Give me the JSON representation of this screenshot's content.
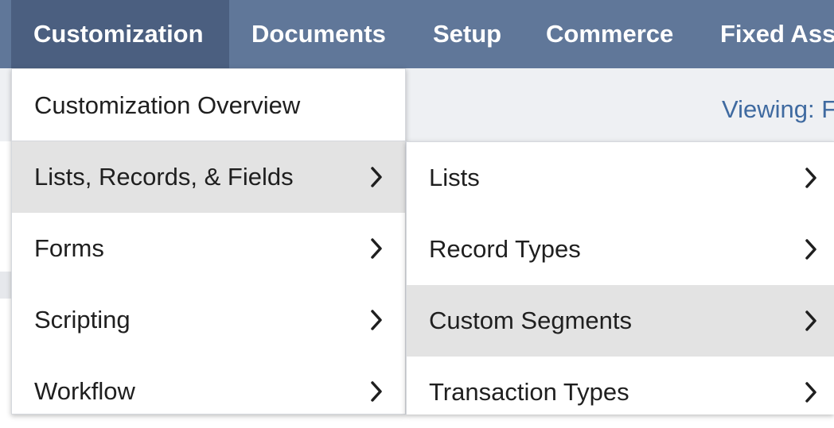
{
  "nav": {
    "tabs": [
      {
        "label": "Customization",
        "active": true
      },
      {
        "label": "Documents"
      },
      {
        "label": "Setup"
      },
      {
        "label": "Commerce"
      },
      {
        "label": "Fixed Ass"
      }
    ]
  },
  "page": {
    "viewing_label": "Viewing: F"
  },
  "menu_level1": {
    "overview": "Customization Overview",
    "items": [
      {
        "label": "Lists, Records, & Fields",
        "highlighted": true
      },
      {
        "label": "Forms"
      },
      {
        "label": "Scripting"
      },
      {
        "label": "Workflow"
      }
    ]
  },
  "menu_level2": {
    "items": [
      {
        "label": "Lists"
      },
      {
        "label": "Record Types"
      },
      {
        "label": "Custom Segments",
        "highlighted": true
      },
      {
        "label": "Transaction Types"
      }
    ]
  },
  "colors": {
    "nav_bg": "#607799",
    "nav_active": "#4b5f80",
    "highlight": "#e3e3e3",
    "link_blue": "#3f6aa0"
  },
  "icons": {
    "submenu_arrow": "chevron-right-icon"
  }
}
